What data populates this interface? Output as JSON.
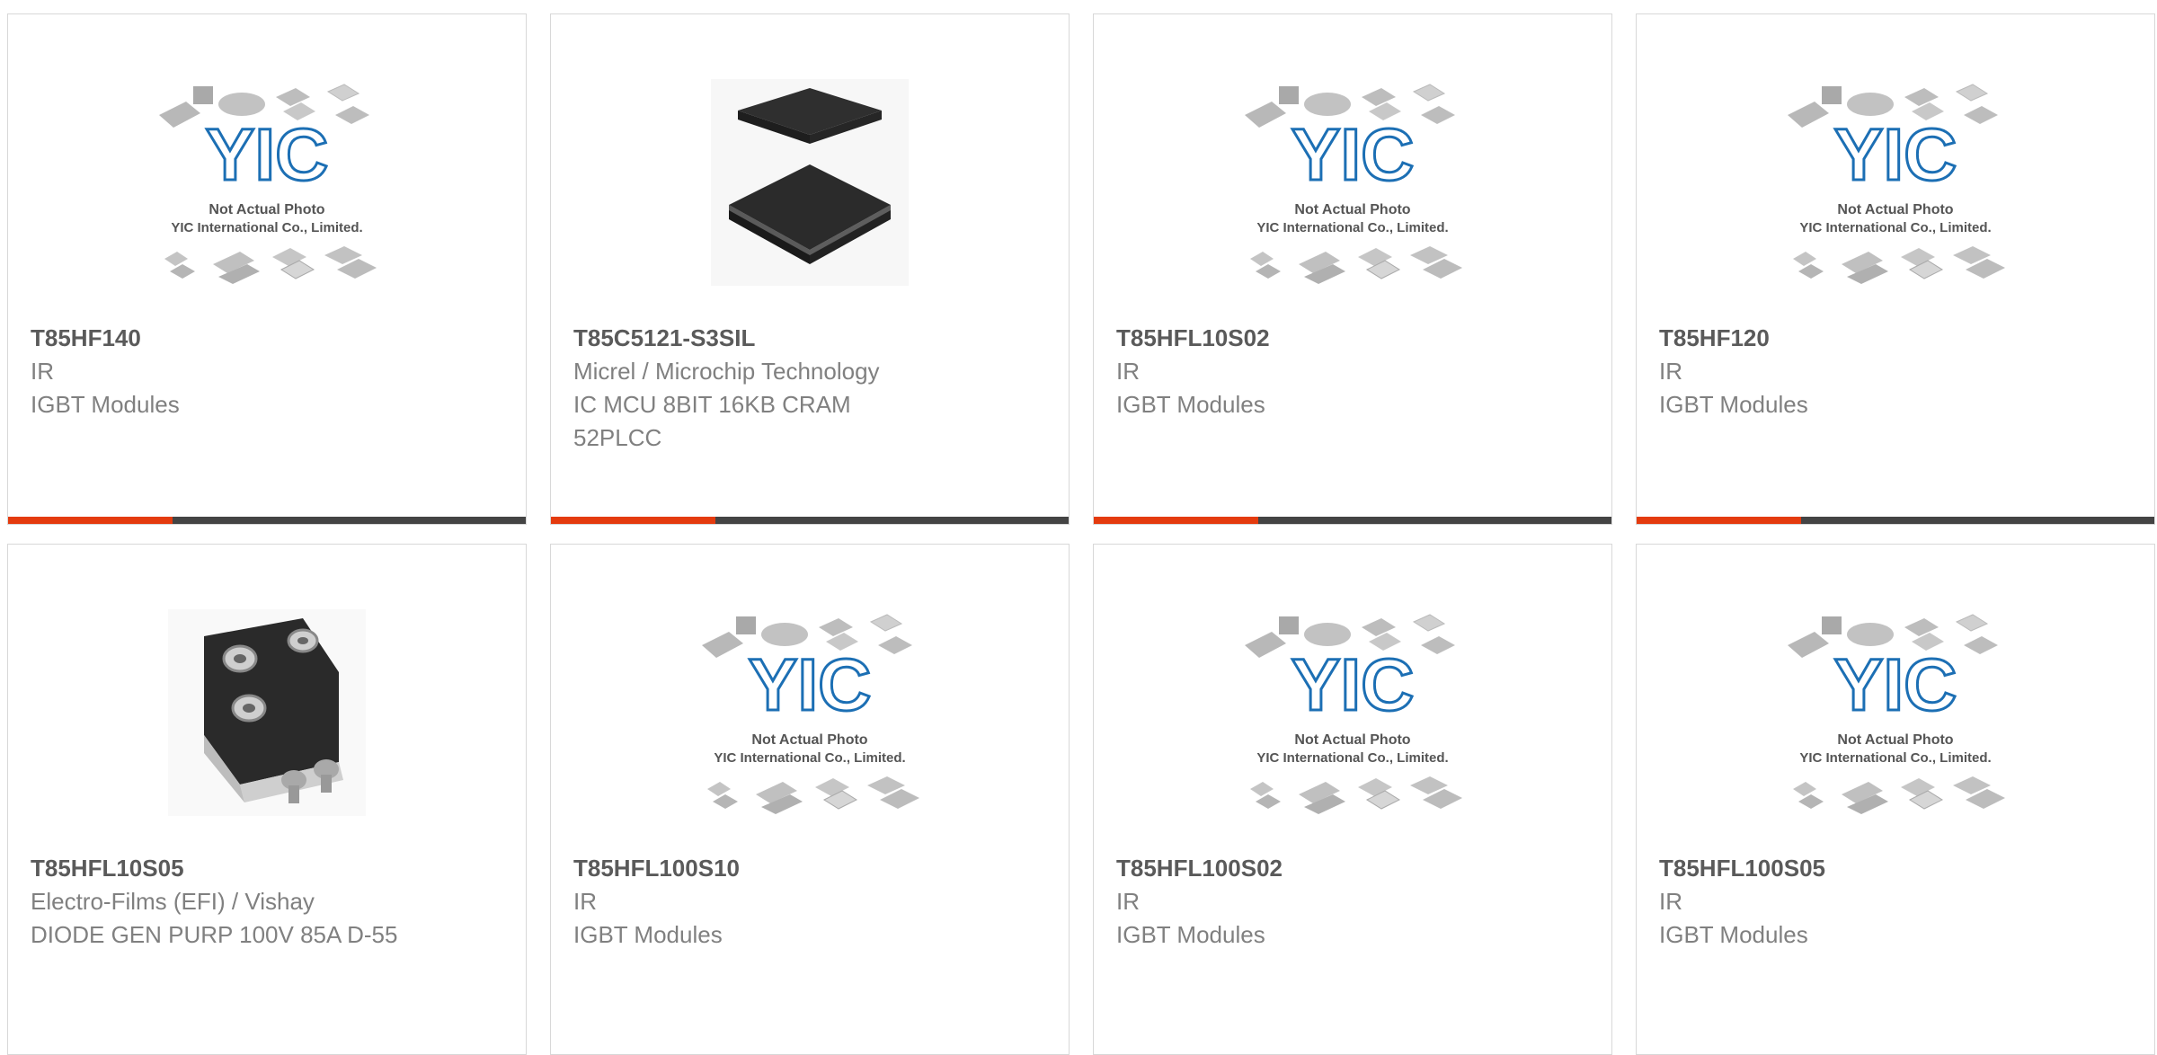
{
  "colors": {
    "accent": "#e43b0e",
    "bar": "#444444",
    "brand_blue": "#1c6fb4"
  },
  "placeholder": {
    "line1": "Not Actual Photo",
    "line2": "YIC International Co., Limited."
  },
  "products": [
    {
      "part": "T85HF140",
      "manufacturer": "IR",
      "description": "IGBT Modules",
      "image": "placeholder-icon"
    },
    {
      "part": "T85C5121-S3SIL",
      "manufacturer": "Micrel / Microchip Technology",
      "description": "IC MCU 8BIT 16KB CRAM 52PLCC",
      "image": "plcc-chip-icon"
    },
    {
      "part": "T85HFL10S02",
      "manufacturer": "IR",
      "description": "IGBT Modules",
      "image": "placeholder-icon"
    },
    {
      "part": "T85HF120",
      "manufacturer": "IR",
      "description": "IGBT Modules",
      "image": "placeholder-icon"
    },
    {
      "part": "T85HFL10S05",
      "manufacturer": "Electro-Films (EFI) / Vishay",
      "description": "DIODE GEN PURP 100V 85A D-55",
      "image": "diode-module-icon"
    },
    {
      "part": "T85HFL100S10",
      "manufacturer": "IR",
      "description": "IGBT Modules",
      "image": "placeholder-icon"
    },
    {
      "part": "T85HFL100S02",
      "manufacturer": "IR",
      "description": "IGBT Modules",
      "image": "placeholder-icon"
    },
    {
      "part": "T85HFL100S05",
      "manufacturer": "IR",
      "description": "IGBT Modules",
      "image": "placeholder-icon"
    }
  ]
}
